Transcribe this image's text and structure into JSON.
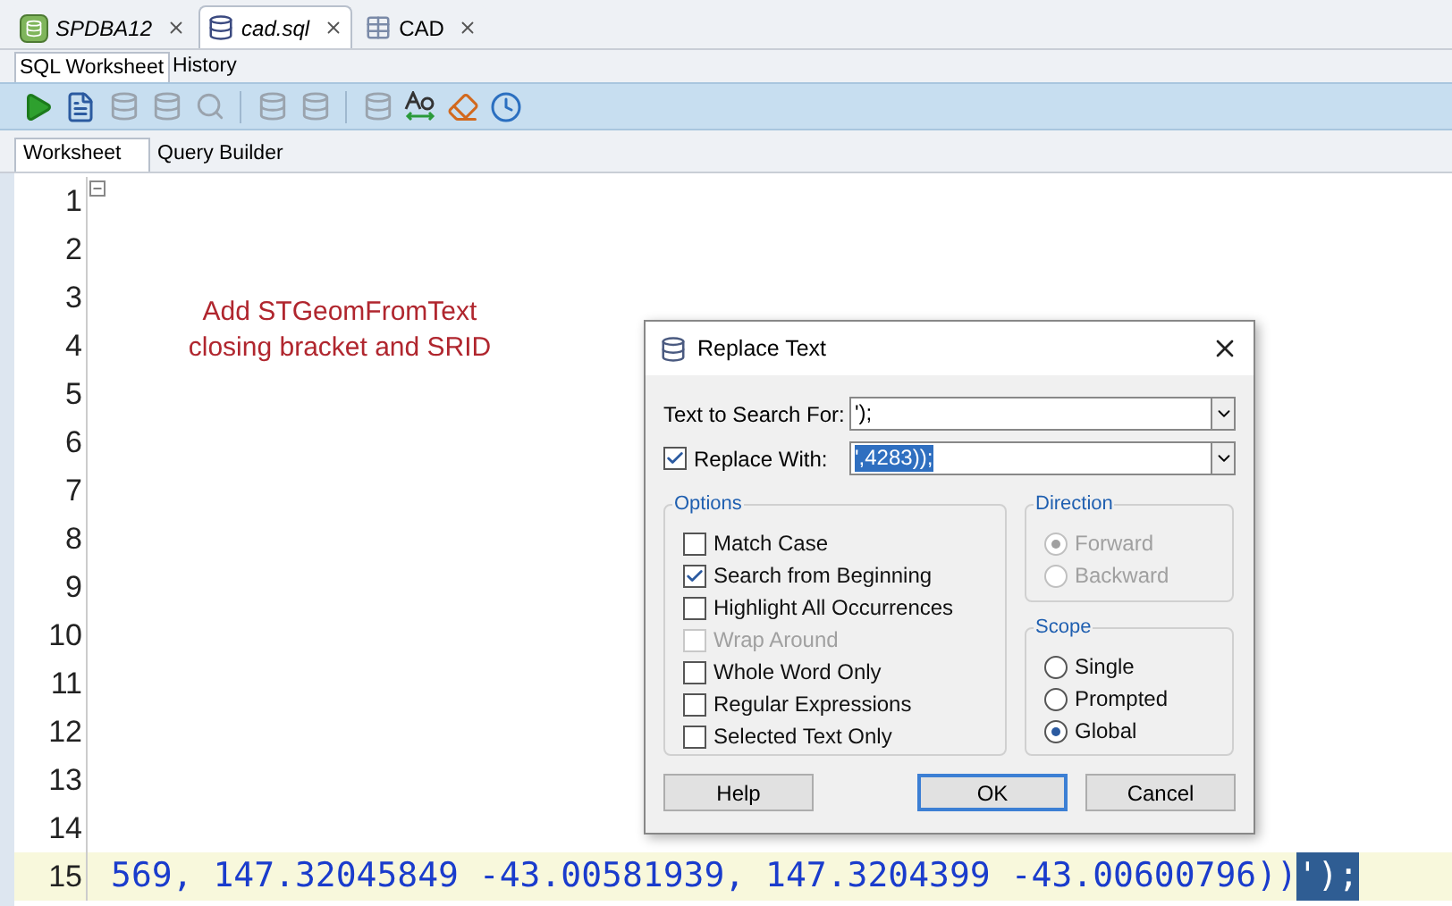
{
  "editor_tabs": [
    {
      "label": "SPDBA12",
      "selected": false
    },
    {
      "label": "cad.sql",
      "selected": true
    },
    {
      "label": "CAD",
      "selected": false
    }
  ],
  "sub_tabs": [
    {
      "label": "SQL Worksheet",
      "selected": true
    },
    {
      "label": "History",
      "selected": false
    }
  ],
  "toolbar": [
    {
      "kind": "play",
      "disabled": false
    },
    {
      "kind": "script",
      "disabled": false
    },
    {
      "kind": "db",
      "disabled": true
    },
    {
      "kind": "db",
      "disabled": true
    },
    {
      "kind": "dbsearch",
      "disabled": true
    },
    {
      "kind": "sep"
    },
    {
      "kind": "db",
      "disabled": true
    },
    {
      "kind": "db",
      "disabled": true
    },
    {
      "kind": "sep"
    },
    {
      "kind": "sqlbox",
      "disabled": true
    },
    {
      "kind": "case",
      "disabled": false
    },
    {
      "kind": "eraser",
      "disabled": false
    },
    {
      "kind": "clock",
      "disabled": false
    }
  ],
  "worksheet_tabs": [
    {
      "label": "Worksheet",
      "selected": true
    },
    {
      "label": "Query Builder",
      "selected": false
    }
  ],
  "lines": [
    {
      "number": "1",
      "foldable": true,
      "current": false
    },
    {
      "number": "2",
      "foldable": false,
      "current": false
    },
    {
      "number": "3",
      "foldable": false,
      "current": false
    },
    {
      "number": "4",
      "foldable": false,
      "current": false
    },
    {
      "number": "5",
      "foldable": false,
      "current": false
    },
    {
      "number": "6",
      "foldable": false,
      "current": false
    },
    {
      "number": "7",
      "foldable": false,
      "current": false
    },
    {
      "number": "8",
      "foldable": false,
      "current": false
    },
    {
      "number": "9",
      "foldable": false,
      "current": false
    },
    {
      "number": "10",
      "foldable": false,
      "current": false
    },
    {
      "number": "11",
      "foldable": false,
      "current": false
    },
    {
      "number": "12",
      "foldable": false,
      "current": false
    },
    {
      "number": "13",
      "foldable": false,
      "current": false
    },
    {
      "number": "14",
      "foldable": false,
      "current": false
    },
    {
      "number": "15",
      "foldable": false,
      "current": true,
      "text": "569, 147.32045849 -43.00581939, 147.3204399 -43.00600796))",
      "selected_text": "');"
    }
  ],
  "annotation": "Add STGeomFromText closing bracket and SRID",
  "dialog": {
    "title": "Replace Text",
    "search_label": "Text to Search For:",
    "search_value": "');",
    "replace_label": "Replace With:",
    "replace_checked": true,
    "replace_value": "',4283));",
    "options_title": "Options",
    "options": [
      {
        "label": "Match Case",
        "checked": false,
        "disabled": false
      },
      {
        "label": "Search from Beginning",
        "checked": true,
        "disabled": false
      },
      {
        "label": "Highlight All Occurrences",
        "checked": false,
        "disabled": false
      },
      {
        "label": "Wrap Around",
        "checked": false,
        "disabled": true
      },
      {
        "label": "Whole Word Only",
        "checked": false,
        "disabled": false
      },
      {
        "label": "Regular Expressions",
        "checked": false,
        "disabled": false
      },
      {
        "label": "Selected Text Only",
        "checked": false,
        "disabled": false
      }
    ],
    "direction_title": "Direction",
    "direction": [
      {
        "label": "Forward",
        "selected": true,
        "disabled": true
      },
      {
        "label": "Backward",
        "selected": false,
        "disabled": true
      }
    ],
    "scope_title": "Scope",
    "scope": [
      {
        "label": "Single",
        "selected": false,
        "disabled": false
      },
      {
        "label": "Prompted",
        "selected": false,
        "disabled": false
      },
      {
        "label": "Global",
        "selected": true,
        "disabled": false
      }
    ],
    "buttons": [
      {
        "label": "Help",
        "default": false
      },
      {
        "label": "OK",
        "default": true
      },
      {
        "label": "Cancel",
        "default": false
      }
    ]
  }
}
